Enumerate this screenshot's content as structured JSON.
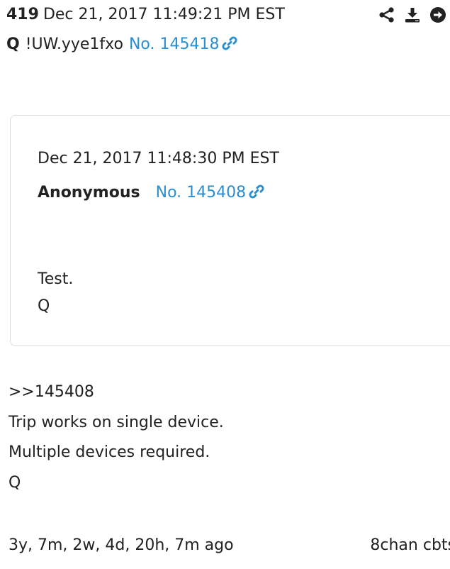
{
  "post": {
    "number": "419",
    "date": "Dec 21, 2017 11:49:21 PM EST",
    "author": "Q",
    "tripcode": "!UW.yye1fxo",
    "post_link": "No. 145418"
  },
  "actions": {
    "icons": [
      "share-icon",
      "download-icon",
      "arrow-right-circle-icon"
    ]
  },
  "quoted": {
    "date": "Dec 21, 2017 11:48:30 PM EST",
    "author": "Anonymous",
    "post_link": "No. 145408",
    "body": [
      "Test.",
      "Q"
    ]
  },
  "body": [
    ">>145408",
    "Trip works on single device.",
    "Multiple devices required.",
    "Q"
  ],
  "footer": {
    "elapsed": "3y, 7m, 2w, 4d, 20h, 7m ago",
    "source": "8chan cbts"
  },
  "colors": {
    "link": "#2a8fd0",
    "text": "#222222",
    "border": "#dcdcdc"
  }
}
